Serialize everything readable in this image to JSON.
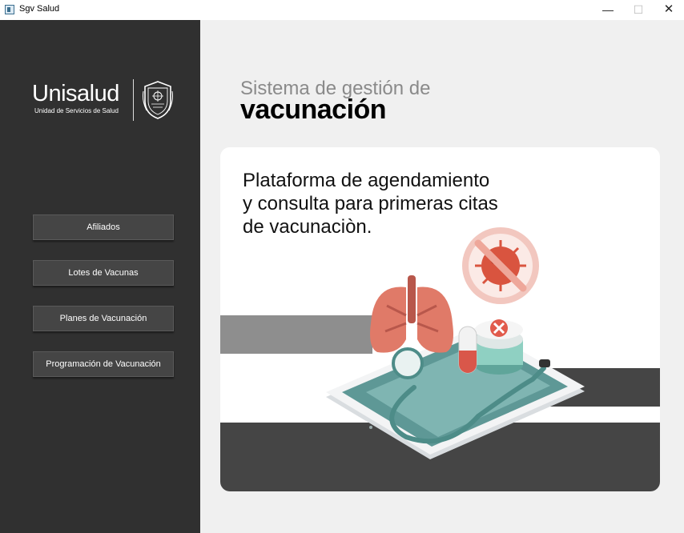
{
  "window": {
    "title": "Sgv Salud",
    "controls": {
      "minimize": "—",
      "maximize": "☐",
      "close": "✕"
    }
  },
  "sidebar": {
    "logo": {
      "name": "Unisalud",
      "subtitle": "Unidad de Servicios de Salud"
    },
    "nav": [
      {
        "label": "Afiliados"
      },
      {
        "label": "Lotes de Vacunas"
      },
      {
        "label": "Planes de Vacunación"
      },
      {
        "label": "Programación de Vacunación"
      }
    ]
  },
  "main": {
    "heading_line1": "Sistema de gestión de",
    "heading_line2": "vacunación",
    "card": {
      "text": "Plataforma de agendamiento y consulta para primeras citas de vacunaciòn."
    }
  },
  "colors": {
    "sidebar_bg": "#303030",
    "button_bg": "#454545",
    "main_bg": "#f0f0f0",
    "card_bg": "#ffffff",
    "lung": "#e07a68",
    "phone_screen": "#6fa8a6",
    "forbidden_ring": "#e8a89d",
    "virus": "#d9543f"
  },
  "icons": [
    "app-icon",
    "crest-icon",
    "minimize-icon",
    "maximize-icon",
    "close-icon"
  ]
}
